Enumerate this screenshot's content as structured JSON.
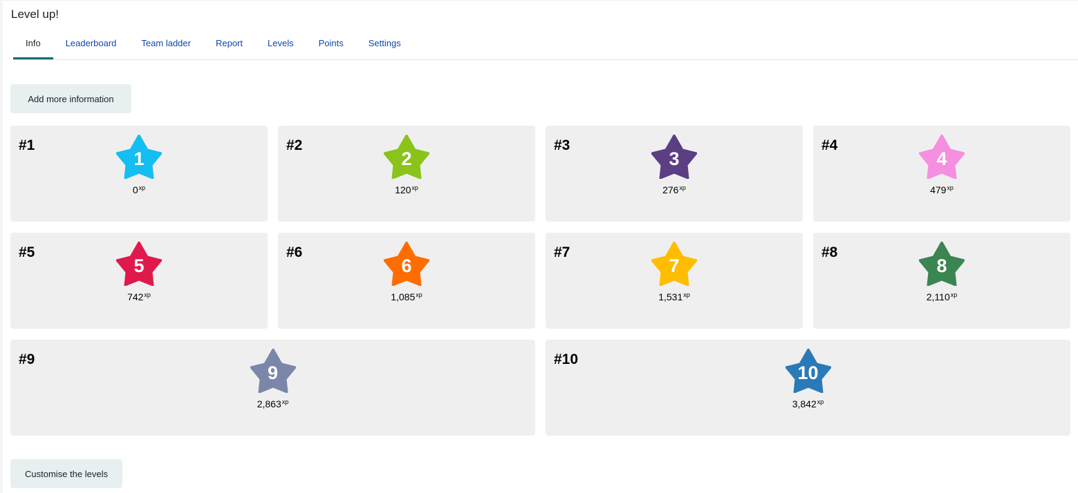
{
  "app": {
    "title": "Level up!"
  },
  "tabs": [
    {
      "label": "Info",
      "active": true
    },
    {
      "label": "Leaderboard",
      "active": false
    },
    {
      "label": "Team ladder",
      "active": false
    },
    {
      "label": "Report",
      "active": false
    },
    {
      "label": "Levels",
      "active": false
    },
    {
      "label": "Points",
      "active": false
    },
    {
      "label": "Settings",
      "active": false
    }
  ],
  "buttons": {
    "add_info": "Add more information",
    "customise": "Customise the levels"
  },
  "xp_unit": "xp",
  "levels": [
    {
      "rank": "#1",
      "badge": "1",
      "xp": "0",
      "color": "#14bdf2"
    },
    {
      "rank": "#2",
      "badge": "2",
      "xp": "120",
      "color": "#8ac31a"
    },
    {
      "rank": "#3",
      "badge": "3",
      "xp": "276",
      "color": "#5c3e83"
    },
    {
      "rank": "#4",
      "badge": "4",
      "xp": "479",
      "color": "#f58fe0"
    },
    {
      "rank": "#5",
      "badge": "5",
      "xp": "742",
      "color": "#e0194d"
    },
    {
      "rank": "#6",
      "badge": "6",
      "xp": "1,085",
      "color": "#ff6d00"
    },
    {
      "rank": "#7",
      "badge": "7",
      "xp": "1,531",
      "color": "#ffbd00"
    },
    {
      "rank": "#8",
      "badge": "8",
      "xp": "2,110",
      "color": "#3a8552"
    },
    {
      "rank": "#9",
      "badge": "9",
      "xp": "2,863",
      "color": "#7a87aa"
    },
    {
      "rank": "#10",
      "badge": "10",
      "xp": "3,842",
      "color": "#2a7ab7"
    }
  ]
}
